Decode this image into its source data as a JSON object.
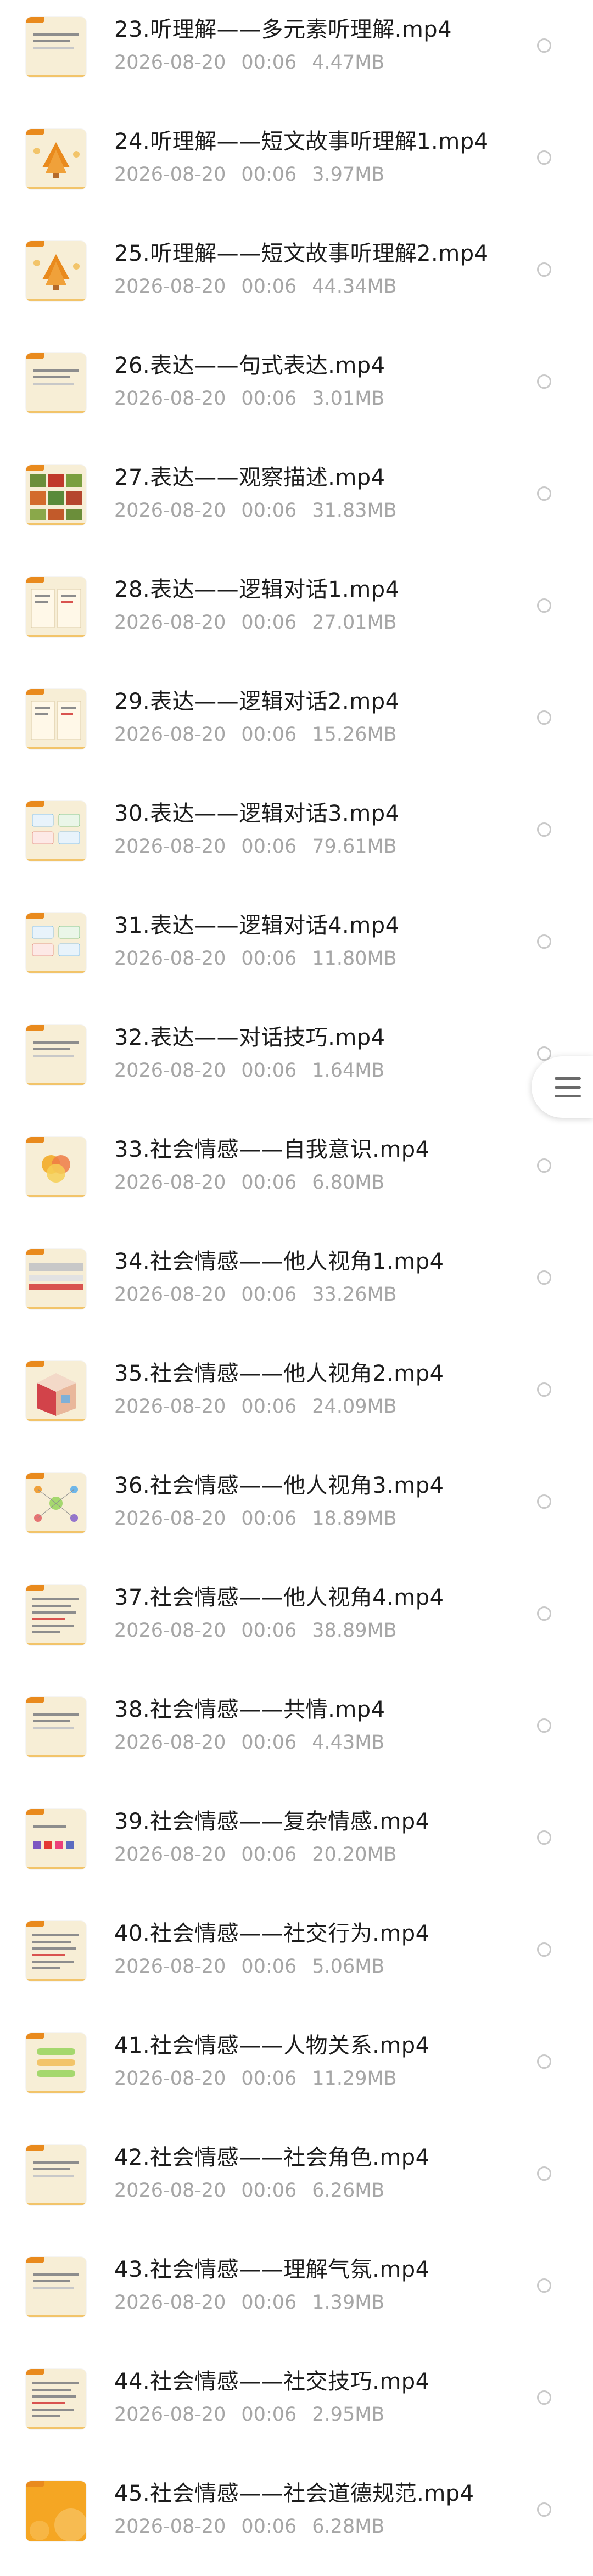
{
  "colors": {
    "title": "#1c1c1c",
    "meta": "#a6a6a6",
    "radio": "#c9c9c9",
    "thumb_bg": "#f7eed6",
    "thumb_accent": "#e98a1d"
  },
  "files": [
    {
      "name": "23.听理解——多元素听理解.mp4",
      "date": "2026-08-20",
      "time": "00:06",
      "size": "4.47MB",
      "thumb": "text"
    },
    {
      "name": "24.听理解——短文故事听理解1.mp4",
      "date": "2026-08-20",
      "time": "00:06",
      "size": "3.97MB",
      "thumb": "tree"
    },
    {
      "name": "25.听理解——短文故事听理解2.mp4",
      "date": "2026-08-20",
      "time": "00:06",
      "size": "44.34MB",
      "thumb": "tree"
    },
    {
      "name": "26.表达——句式表达.mp4",
      "date": "2026-08-20",
      "time": "00:06",
      "size": "3.01MB",
      "thumb": "text"
    },
    {
      "name": "27.表达——观察描述.mp4",
      "date": "2026-08-20",
      "time": "00:06",
      "size": "31.83MB",
      "thumb": "grid"
    },
    {
      "name": "28.表达——逻辑对话1.mp4",
      "date": "2026-08-20",
      "time": "00:06",
      "size": "27.01MB",
      "thumb": "book"
    },
    {
      "name": "29.表达——逻辑对话2.mp4",
      "date": "2026-08-20",
      "time": "00:06",
      "size": "15.26MB",
      "thumb": "book"
    },
    {
      "name": "30.表达——逻辑对话3.mp4",
      "date": "2026-08-20",
      "time": "00:06",
      "size": "79.61MB",
      "thumb": "cards"
    },
    {
      "name": "31.表达——逻辑对话4.mp4",
      "date": "2026-08-20",
      "time": "00:06",
      "size": "11.80MB",
      "thumb": "cards"
    },
    {
      "name": "32.表达——对话技巧.mp4",
      "date": "2026-08-20",
      "time": "00:06",
      "size": "1.64MB",
      "thumb": "text"
    },
    {
      "name": "33.社会情感——自我意识.mp4",
      "date": "2026-08-20",
      "time": "00:06",
      "size": "6.80MB",
      "thumb": "circles"
    },
    {
      "name": "34.社会情感——他人视角1.mp4",
      "date": "2026-08-20",
      "time": "00:06",
      "size": "33.26MB",
      "thumb": "banner"
    },
    {
      "name": "35.社会情感——他人视角2.mp4",
      "date": "2026-08-20",
      "time": "00:06",
      "size": "24.09MB",
      "thumb": "room"
    },
    {
      "name": "36.社会情感——他人视角3.mp4",
      "date": "2026-08-20",
      "time": "00:06",
      "size": "18.89MB",
      "thumb": "mind"
    },
    {
      "name": "37.社会情感——他人视角4.mp4",
      "date": "2026-08-20",
      "time": "00:06",
      "size": "38.89MB",
      "thumb": "lines"
    },
    {
      "name": "38.社会情感——共情.mp4",
      "date": "2026-08-20",
      "time": "00:06",
      "size": "4.43MB",
      "thumb": "text"
    },
    {
      "name": "39.社会情感——复杂情感.mp4",
      "date": "2026-08-20",
      "time": "00:06",
      "size": "20.20MB",
      "thumb": "swatches"
    },
    {
      "name": "40.社会情感——社交行为.mp4",
      "date": "2026-08-20",
      "time": "00:06",
      "size": "5.06MB",
      "thumb": "lines"
    },
    {
      "name": "41.社会情感——人物关系.mp4",
      "date": "2026-08-20",
      "time": "00:06",
      "size": "11.29MB",
      "thumb": "bars"
    },
    {
      "name": "42.社会情感——社会角色.mp4",
      "date": "2026-08-20",
      "time": "00:06",
      "size": "6.26MB",
      "thumb": "text"
    },
    {
      "name": "43.社会情感——理解气氛.mp4",
      "date": "2026-08-20",
      "time": "00:06",
      "size": "1.39MB",
      "thumb": "text"
    },
    {
      "name": "44.社会情感——社交技巧.mp4",
      "date": "2026-08-20",
      "time": "00:06",
      "size": "2.95MB",
      "thumb": "lines"
    },
    {
      "name": "45.社会情感——社会道德规范.mp4",
      "date": "2026-08-20",
      "time": "00:06",
      "size": "6.28MB",
      "thumb": "orange"
    }
  ],
  "side_menu": {
    "icon": "menu-icon"
  }
}
